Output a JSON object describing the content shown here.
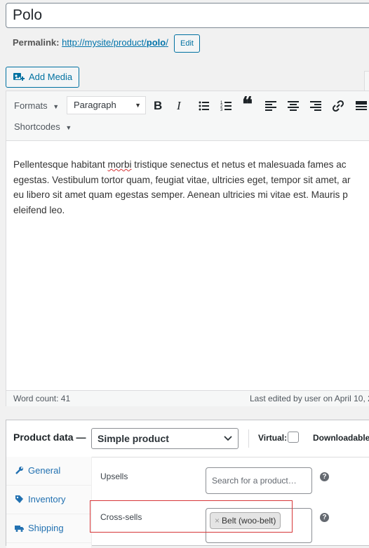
{
  "post": {
    "title": "Polo"
  },
  "permalink": {
    "label": "Permalink:",
    "url_base": "http://mysite/product/",
    "slug": "polo",
    "trailing": "/",
    "edit_label": "Edit"
  },
  "media": {
    "add_media_label": "Add Media"
  },
  "editor": {
    "formats_label": "Formats",
    "block_format": "Paragraph",
    "shortcodes_label": "Shortcodes",
    "toolbar_icons": [
      "bold-icon",
      "italic-icon",
      "bullet-list-icon",
      "numbered-list-icon",
      "blockquote-icon",
      "align-left-icon",
      "align-center-icon",
      "align-right-icon",
      "link-icon",
      "toolbar-toggle-icon"
    ],
    "content_lines": [
      {
        "before": "Pellentesque habitant ",
        "misspelled": "morbi",
        "after": " tristique senectus et netus et malesuada fames ac"
      },
      {
        "text": "egestas. Vestibulum tortor quam, feugiat vitae, ultricies eget, tempor sit amet, ar"
      },
      {
        "text": "eu libero sit amet quam egestas semper. Aenean ultricies mi vitae est. Mauris p"
      },
      {
        "text": "eleifend leo."
      }
    ],
    "word_count": "Word count: 41",
    "last_edited": "Last edited by user on April 10, 2"
  },
  "product_data": {
    "title": "Product data —",
    "type": "Simple product",
    "virtual_label": "Virtual:",
    "downloadable_label": "Downloadable:",
    "tabs": [
      {
        "label": "General",
        "icon": "wrench-icon"
      },
      {
        "label": "Inventory",
        "icon": "tag-icon"
      },
      {
        "label": "Shipping",
        "icon": "truck-icon"
      }
    ],
    "upsells_label": "Upsells",
    "upsells_placeholder": "Search for a product…",
    "crosssells_label": "Cross-sells",
    "crosssells_tag": "Belt (woo-belt)",
    "tag_remove": "×",
    "help_glyph": "?"
  },
  "colors": {
    "link": "#0073aa",
    "button_border": "#0071a1",
    "highlight": "#d63638"
  }
}
